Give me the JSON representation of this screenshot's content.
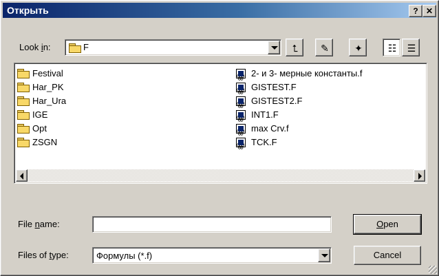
{
  "window": {
    "title": "Открыть",
    "help_glyph": "?",
    "close_glyph": "✕"
  },
  "lookin": {
    "label_pre": "Look ",
    "label_u": "i",
    "label_post": "n:",
    "value": "F"
  },
  "toolbar": {
    "up_glyph": "⮤",
    "desktop_glyph": "✎",
    "newfolder_glyph": "✦",
    "list_glyph": "☷",
    "details_glyph": "☰"
  },
  "files": {
    "folders": [
      "Festival",
      "Har_PK",
      "Har_Ura",
      "IGE",
      "Opt",
      "ZSGN"
    ],
    "documents": [
      "2- и 3- мерные константы.f",
      "GISTEST.F",
      "GISTEST2.F",
      "INT1.F",
      "max Crv.f",
      "TCK.F"
    ]
  },
  "filename": {
    "label_pre": "File ",
    "label_u": "n",
    "label_post": "ame:",
    "value": ""
  },
  "filetype": {
    "label_pre": "Files of ",
    "label_u": "t",
    "label_post": "ype:",
    "value": "Формулы (*.f)"
  },
  "buttons": {
    "open_u": "O",
    "open_rest": "pen",
    "cancel": "Cancel"
  }
}
